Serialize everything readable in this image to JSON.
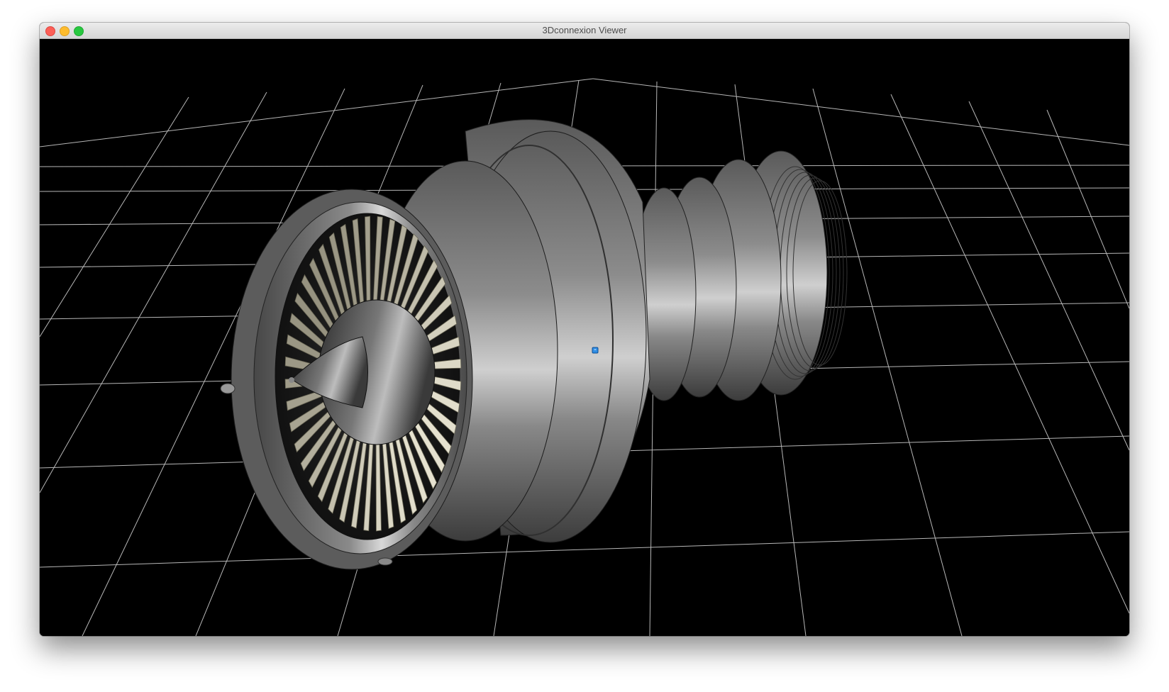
{
  "window": {
    "title": "3Dconnexion Viewer"
  },
  "viewport": {
    "background": "#000000",
    "grid_color": "#d8d8d8",
    "model_name": "jet-engine",
    "model_color": "#7a7a7a",
    "blade_color": "#dcd8c6",
    "navigation_icon": "3dconnexion-cube-icon"
  }
}
